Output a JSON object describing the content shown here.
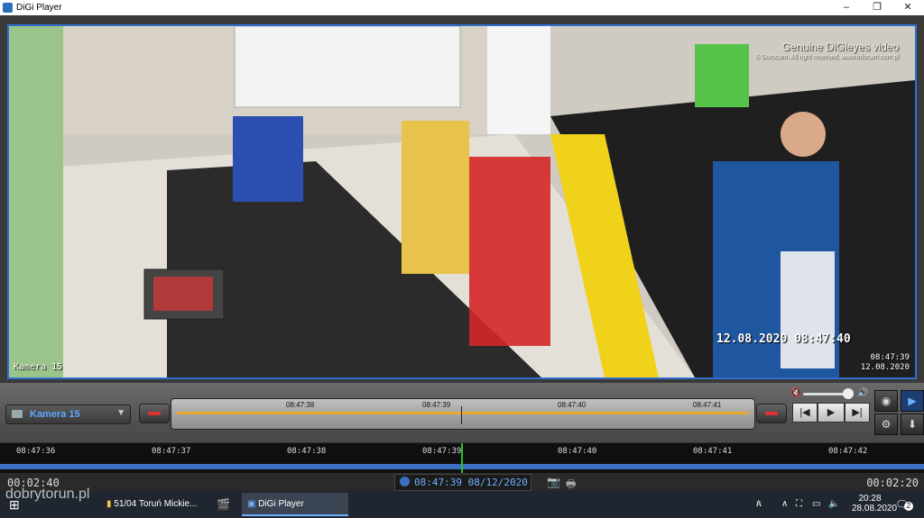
{
  "window": {
    "title": "DiGi Player",
    "minimize": "–",
    "maximize": "❐",
    "close": "✕"
  },
  "video": {
    "watermark_title": "Genuine DiGieyes video",
    "watermark_sub": "© Dorocam. All right reserved, www.infocam.com.pl",
    "timestamp": "12.08.2020  08:47:40",
    "camera_label": "Kamera 15",
    "corner_time": "08:47:39",
    "corner_date": "12.08.2020"
  },
  "controls": {
    "camera_select": "Kamera 15",
    "mini_ticks": [
      "08:47:38",
      "08:47:39",
      "08:47:40",
      "08:47:41"
    ],
    "play_icons": {
      "prev": "|◀",
      "play": "▶",
      "next": "▶|"
    }
  },
  "timeline": {
    "ticks": [
      "08:47:36",
      "08:47:37",
      "08:47:38",
      "08:47:39",
      "08:47:40",
      "08:47:41",
      "08:47:42"
    ],
    "left_time": "00:02:40",
    "right_time": "00:02:20",
    "current": "08:47:39 08/12/2020"
  },
  "taskbar": {
    "task1": "51/04 Toruń Mickie...",
    "task2": "DiGi Player",
    "time": "20:28",
    "date": "28.08.2020",
    "notif": "2"
  },
  "branding": {
    "site": "dobrytorun.pl"
  }
}
